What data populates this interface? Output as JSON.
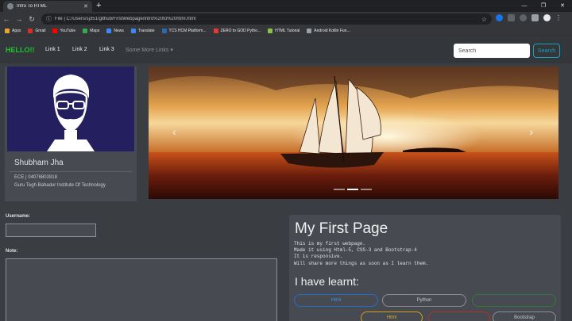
{
  "browser": {
    "tab_title": "Intro To HTML",
    "url": "File | C:/Users/sj351/github/FirstWebpage/intro%20to%20html.html",
    "bookmarks": [
      "Apps",
      "Gmail",
      "YouTube",
      "Maps",
      "News",
      "Translate",
      "TCS HCM Platform...",
      "ZERO to GOD Pytho...",
      "HTML Tutorial",
      "Android Kotlin Fun..."
    ],
    "bookmark_colors": [
      "#e5a530",
      "#d93025",
      "#ff0000",
      "#34a853",
      "#4285f4",
      "#4285f4",
      "#2b6cb0",
      "#e53935",
      "#8bc34a",
      "#9aa0a6"
    ]
  },
  "navbar": {
    "brand": "HELLO!!",
    "links": [
      "Link 1",
      "Link 2",
      "Link 3"
    ],
    "dropdown_label": "Some More Links",
    "search_placeholder": "Search",
    "search_button": "Search"
  },
  "profile": {
    "name": "Shubham Jha",
    "line1": "ECE | 04076802818",
    "line2": "Guru Tegh Bahadur Institute Of Technology"
  },
  "form": {
    "username_label": "Username:",
    "note_label": "Note:"
  },
  "panel": {
    "title": "My First Page",
    "lines": [
      "This is my first webpage.",
      "Made it using Html-5, CSS-3 and Bootstrap-4",
      "It is responsive.",
      "Will share more things as soon as I learn them."
    ],
    "subtitle": "I have learnt:",
    "skills": [
      "Html",
      "Python",
      "",
      "Html",
      "",
      "Bootstrap"
    ]
  }
}
